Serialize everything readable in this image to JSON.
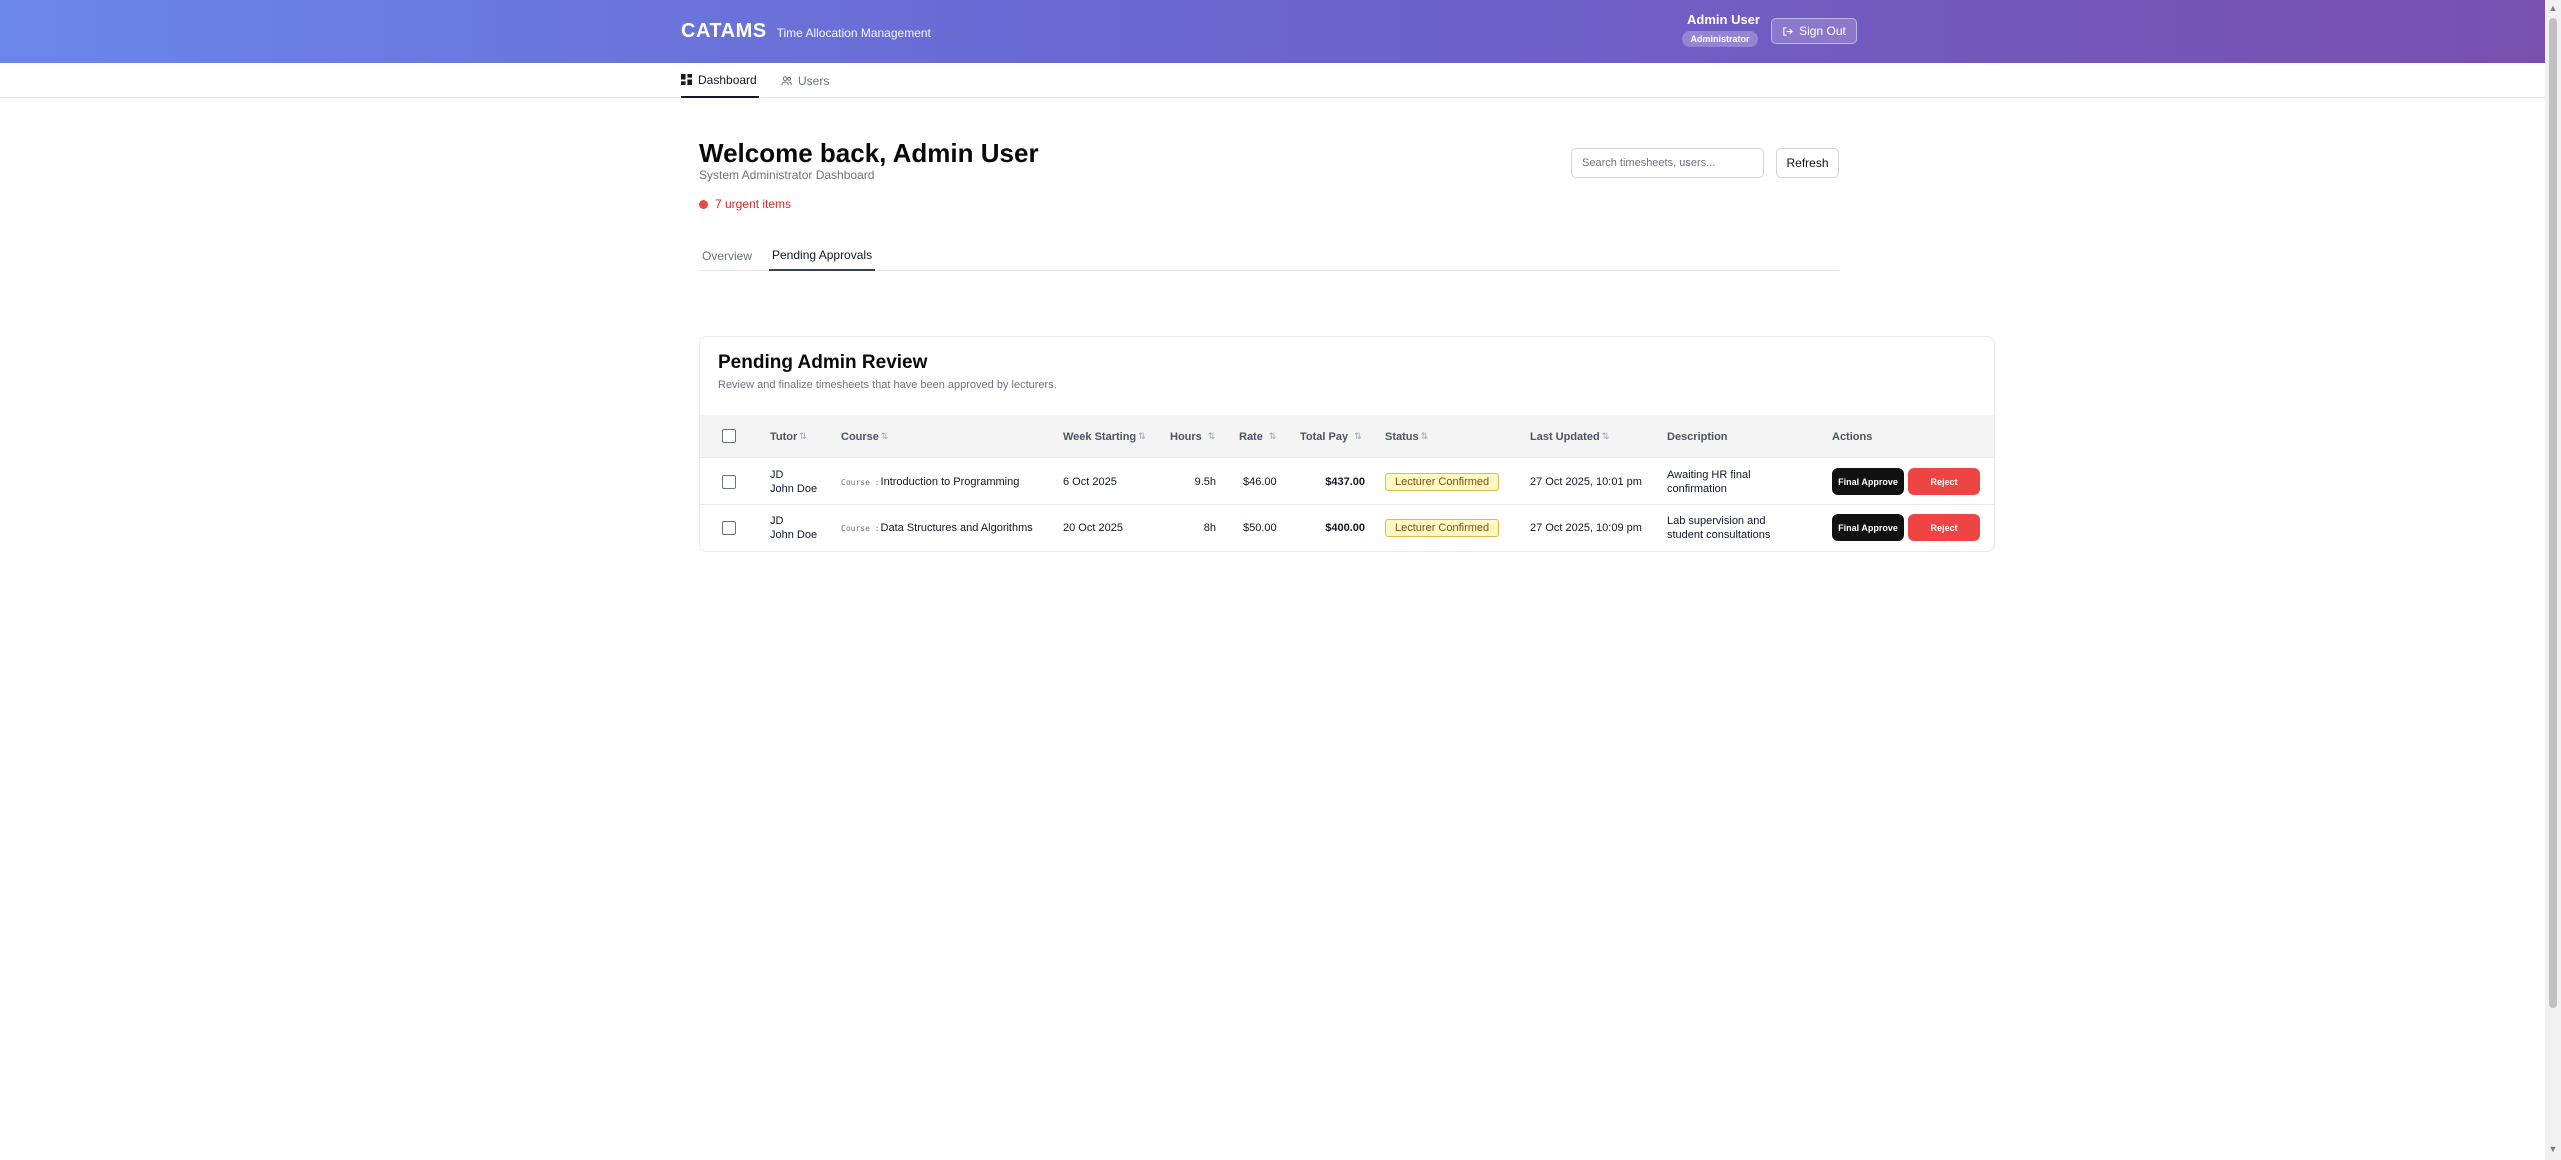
{
  "header": {
    "brand": "CATAMS",
    "subtitle": "Time Allocation Management",
    "user_name": "Admin User",
    "role": "Administrator",
    "signout_label": "Sign Out"
  },
  "nav": {
    "dashboard": "Dashboard",
    "users": "Users"
  },
  "welcome": {
    "title": "Welcome back, Admin User",
    "subtitle": "System Administrator Dashboard",
    "urgent": "7 urgent items"
  },
  "search": {
    "placeholder": "Search timesheets, users..."
  },
  "refresh_label": "Refresh",
  "tabs": {
    "overview": "Overview",
    "pending": "Pending Approvals"
  },
  "card": {
    "title": "Pending Admin Review",
    "description": "Review and finalize timesheets that have been approved by lecturers."
  },
  "table": {
    "columns": {
      "tutor": "Tutor",
      "course": "Course",
      "week": "Week Starting",
      "hours": "Hours",
      "rate": "Rate",
      "total": "Total Pay",
      "status": "Status",
      "updated": "Last Updated",
      "description": "Description",
      "actions": "Actions"
    },
    "sort_glyph": "⇅",
    "course_prefix": "Course :",
    "approve_label": "Final Approve",
    "reject_label": "Reject",
    "rows": [
      {
        "initials": "JD",
        "tutor": "John Doe",
        "course": "Introduction to Programming",
        "week": "6 Oct 2025",
        "hours": "9.5h",
        "rate": "$46.00",
        "total": "$437.00",
        "status": "Lecturer Confirmed",
        "updated": "27 Oct 2025, 10:01 pm",
        "description": "Awaiting HR final confirmation"
      },
      {
        "initials": "JD",
        "tutor": "John Doe",
        "course": "Data Structures and Algorithms",
        "week": "20 Oct 2025",
        "hours": "8h",
        "rate": "$50.00",
        "total": "$400.00",
        "status": "Lecturer Confirmed",
        "updated": "27 Oct 2025, 10:09 pm",
        "description": "Lab supervision and student consultations"
      }
    ]
  }
}
